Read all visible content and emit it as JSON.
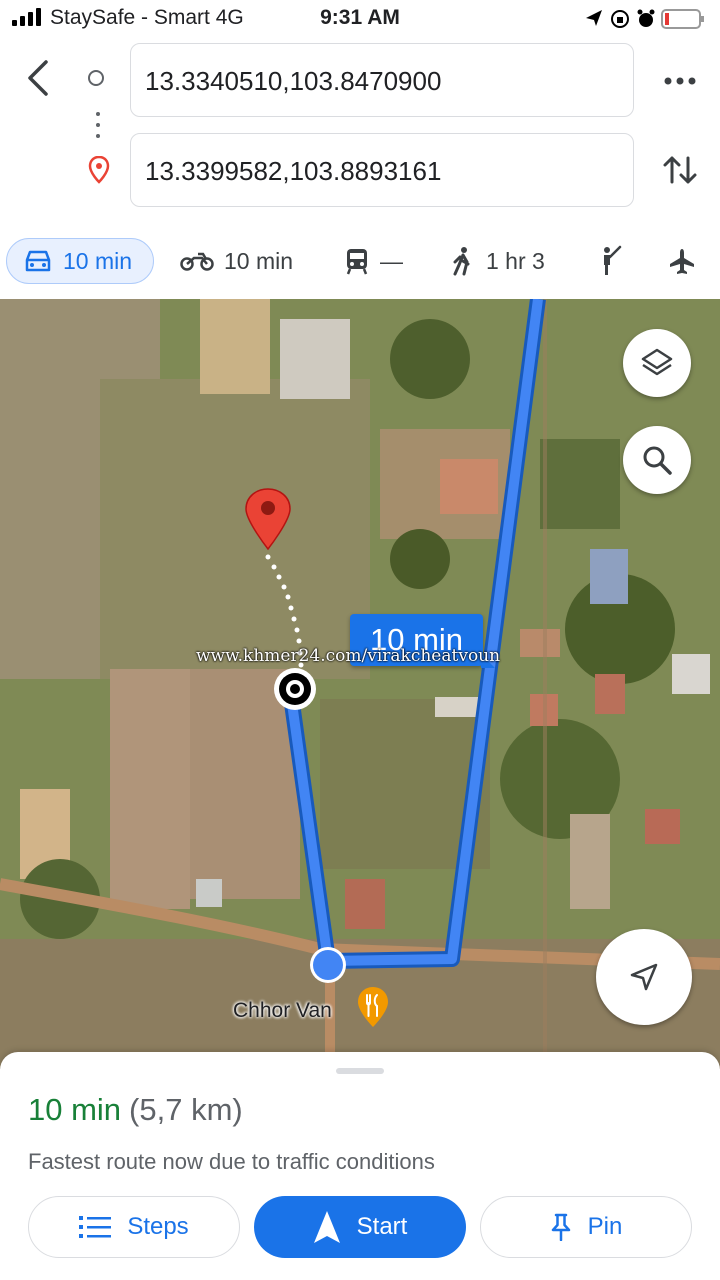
{
  "status_bar": {
    "carrier": "StaySafe - Smart  4G",
    "time": "9:31 AM"
  },
  "directions": {
    "origin": "13.3340510,103.8470900",
    "destination": "13.3399582,103.8893161"
  },
  "travel_modes": [
    {
      "mode": "car-icon",
      "label": "10 min",
      "selected": true
    },
    {
      "mode": "motorbike-icon",
      "label": "10 min"
    },
    {
      "mode": "transit-icon",
      "label": "—"
    },
    {
      "mode": "walk-icon",
      "label": "1 hr 3"
    },
    {
      "mode": "ride-hail-icon",
      "label": ""
    },
    {
      "mode": "flight-icon",
      "label": ""
    }
  ],
  "map": {
    "route_label": "10 min",
    "watermark": "www.khmer24.com/virakcheatvoun",
    "place_label": "Chhor Van",
    "route_color": "#1a73e8"
  },
  "summary": {
    "duration": "10 min",
    "distance": "(5,7 km)",
    "note": "Fastest route now due to traffic conditions"
  },
  "actions": {
    "steps": "Steps",
    "start": "Start",
    "pin": "Pin"
  },
  "colors": {
    "accent": "#1a73e8",
    "duration_green": "#188038",
    "destination_red": "#ea4335"
  }
}
